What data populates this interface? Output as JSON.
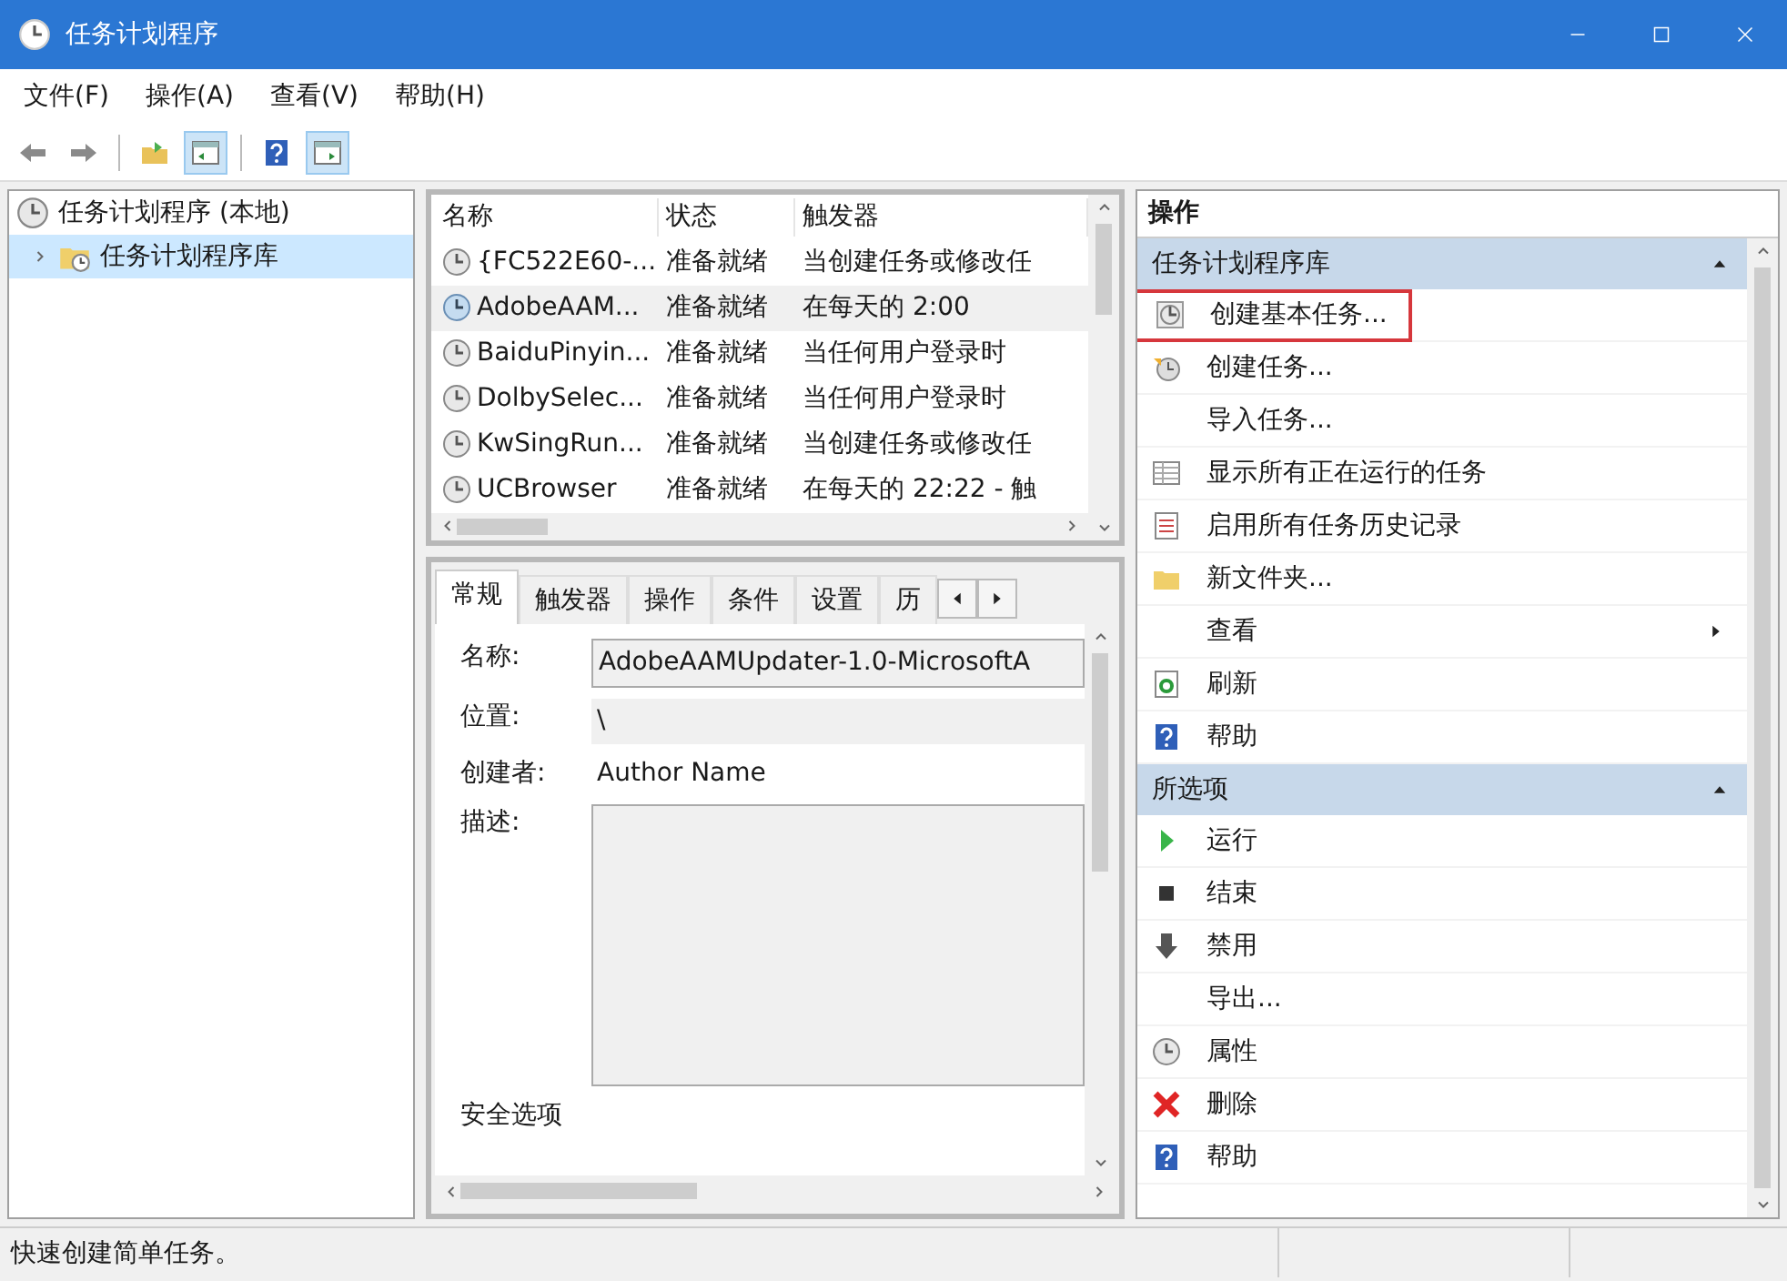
{
  "window": {
    "title": "任务计划程序"
  },
  "menu": [
    "文件(F)",
    "操作(A)",
    "查看(V)",
    "帮助(H)"
  ],
  "toolbar": [
    {
      "selected": false
    },
    {
      "selected": false
    },
    {
      "selected": false
    },
    {
      "selected": true
    },
    {
      "selected": false
    },
    {
      "selected": true
    }
  ],
  "tree": [
    {
      "label": "任务计划程序 (本地)",
      "expanded": true,
      "selected": false,
      "children": [
        {
          "label": "任务计划程序库",
          "expanded": false,
          "selected": true
        }
      ]
    }
  ],
  "task_list": {
    "columns": [
      "名称",
      "状态",
      "触发器"
    ],
    "rows": [
      {
        "name": "{FC522E60-...",
        "status": "准备就绪",
        "trigger": "当创建任务或修改任",
        "selected": false
      },
      {
        "name": "AdobeAAM...",
        "status": "准备就绪",
        "trigger": "在每天的 2:00",
        "selected": true
      },
      {
        "name": "BaiduPinyin...",
        "status": "准备就绪",
        "trigger": "当任何用户登录时",
        "selected": false
      },
      {
        "name": "DolbySelec...",
        "status": "准备就绪",
        "trigger": "当任何用户登录时",
        "selected": false
      },
      {
        "name": "KwSingRun...",
        "status": "准备就绪",
        "trigger": "当创建任务或修改任",
        "selected": false
      },
      {
        "name": "UCBrowser",
        "status": "准备就绪",
        "trigger": "在每天的 22:22 - 触",
        "selected": false
      }
    ]
  },
  "details": {
    "tabs": [
      {
        "label": "常规",
        "selected": true
      },
      {
        "label": "触发器",
        "selected": false
      },
      {
        "label": "操作",
        "selected": false
      },
      {
        "label": "条件",
        "selected": false
      },
      {
        "label": "设置",
        "selected": false
      },
      {
        "label": "历",
        "selected": false
      }
    ],
    "fields": [
      {
        "kind": "input",
        "label": "名称:",
        "value": "AdobeAAMUpdater-1.0-MicrosoftA"
      },
      {
        "kind": "readonly",
        "label": "位置:",
        "value": "\\"
      },
      {
        "kind": "text",
        "label": "创建者:",
        "value": "Author Name"
      },
      {
        "kind": "textarea",
        "label": "描述:"
      }
    ],
    "section_heading": "安全选项"
  },
  "actions": {
    "title": "操作",
    "sections": [
      {
        "title": "任务计划程序库",
        "expanded": true,
        "items": [
          {
            "label": "创建基本任务...",
            "highlighted": true
          },
          {
            "label": "创建任务...",
            "highlighted": false
          },
          {
            "label": "导入任务...",
            "highlighted": false
          },
          {
            "label": "显示所有正在运行的任务",
            "highlighted": false
          },
          {
            "label": "启用所有任务历史记录",
            "highlighted": false
          },
          {
            "label": "新文件夹...",
            "highlighted": false
          },
          {
            "label": "查看",
            "highlighted": false,
            "submenu": true
          },
          {
            "label": "刷新",
            "highlighted": false
          },
          {
            "label": "帮助",
            "highlighted": false
          }
        ]
      },
      {
        "title": "所选项",
        "expanded": true,
        "items": [
          {
            "label": "运行",
            "highlighted": false
          },
          {
            "label": "结束",
            "highlighted": false
          },
          {
            "label": "禁用",
            "highlighted": false
          },
          {
            "label": "导出...",
            "highlighted": false
          },
          {
            "label": "属性",
            "highlighted": false
          },
          {
            "label": "删除",
            "highlighted": false
          },
          {
            "label": "帮助",
            "highlighted": false
          }
        ]
      }
    ]
  },
  "status_bar": "快速创建简单任务。"
}
